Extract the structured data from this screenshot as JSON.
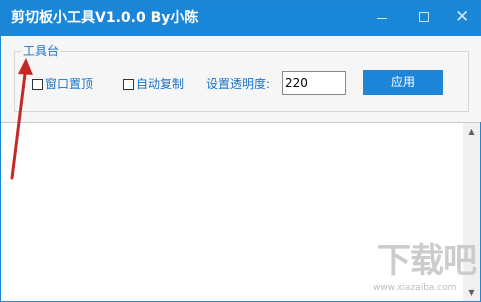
{
  "window": {
    "title": "剪切板小工具V1.0.0  By小陈",
    "controls": {
      "minimize": "—",
      "maximize": "☐",
      "close": "✕"
    }
  },
  "toolbar": {
    "group_label": "工具台",
    "checkbox_topmost": {
      "label": "窗口置顶",
      "checked": false
    },
    "checkbox_autocopy": {
      "label": "自动复制",
      "checked": false
    },
    "opacity_label": "设置透明度:",
    "opacity_value": "220",
    "apply_label": "应用"
  },
  "content": {
    "text": ""
  },
  "watermark": {
    "text": "下载吧",
    "url": "www.xiazaiba.com"
  },
  "colors": {
    "titlebar": "#1a86d8",
    "accent_text": "#1a73c8",
    "button": "#1e86d8",
    "annotation_arrow": "#c62828"
  }
}
